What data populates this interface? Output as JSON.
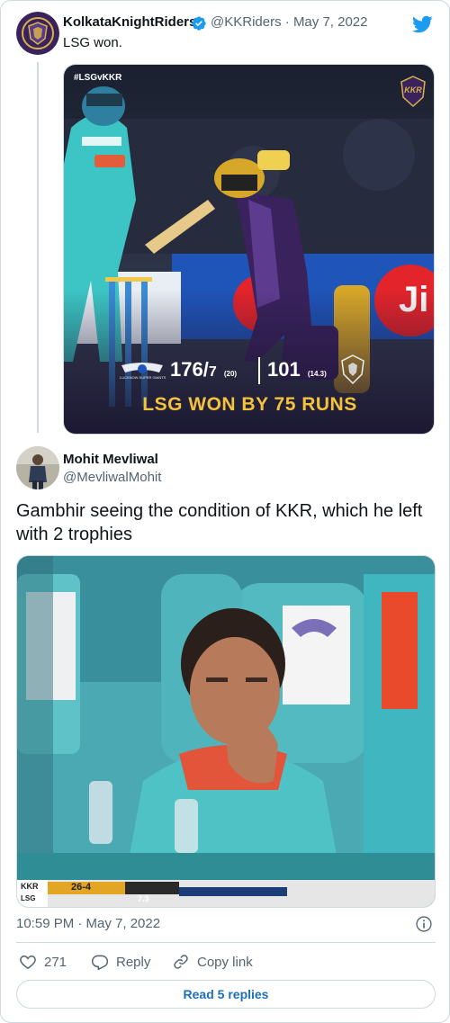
{
  "tweet1": {
    "display_name": "KolkataKnightRiders",
    "handle": "@KKRiders",
    "date": "May 7, 2022",
    "text": "LSG won.",
    "media": {
      "hashtag": "#LSGvKKR",
      "score_lsg": "176/",
      "score_lsg_wkts": "7",
      "score_lsg_overs": "(20)",
      "score_kkr": "101",
      "score_kkr_overs": "(14.3)",
      "result": "LSG WON BY 75 RUNS",
      "team_logo_text": "KKR",
      "lsg_logo_text": "LUCKNOW SUPER GIANTS"
    }
  },
  "tweet2": {
    "display_name": "Mohit Mevliwal",
    "handle": "@MevliwalMohit",
    "text": "Gambhir seeing the condition of KKR, which he left with 2 trophies",
    "media": {
      "scoreboard_team": "KKR",
      "scoreboard_score": "26-4",
      "scoreboard_overs": "7.3",
      "scoreboard_vs": "LSG"
    },
    "timestamp": "10:59 PM · May 7, 2022",
    "likes": "271",
    "reply_label": "Reply",
    "copy_label": "Copy link",
    "read_replies_label": "Read 5 replies"
  },
  "colors": {
    "twitter_blue": "#1d9bf0",
    "link_blue": "#1d6fb8",
    "kkr_purple": "#3a225d",
    "lsg_teal": "#3cc5c4",
    "result_yellow": "#f5c23b"
  }
}
